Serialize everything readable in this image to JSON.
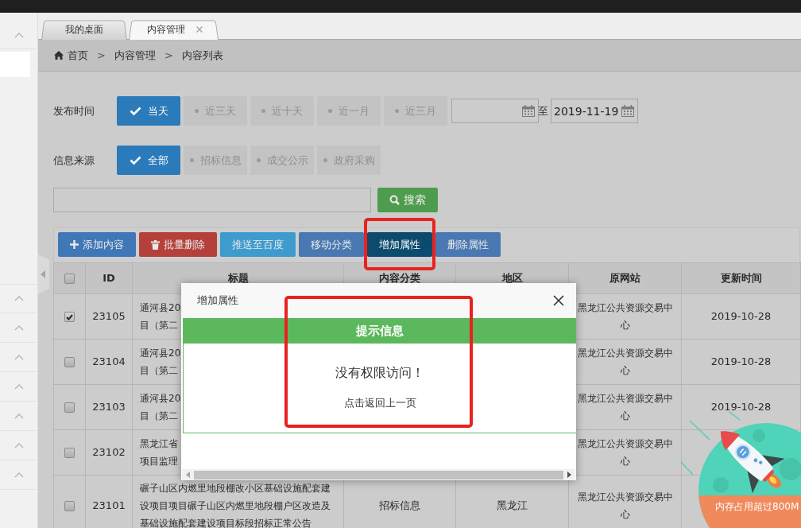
{
  "tabs": [
    {
      "label": "我的桌面",
      "selected": false,
      "closable": false
    },
    {
      "label": "内容管理",
      "selected": true,
      "closable": true
    }
  ],
  "breadcrumb": [
    {
      "kind": "home",
      "label": "首页"
    },
    {
      "kind": "separator",
      "label": ">"
    },
    {
      "kind": "link",
      "label": "内容管理"
    },
    {
      "kind": "separator",
      "label": ">"
    },
    {
      "kind": "current",
      "label": "内容列表"
    }
  ],
  "filters": [
    {
      "label": "发布时间",
      "options": [
        {
          "label": "当天",
          "selected": true
        },
        {
          "label": "近三天",
          "selected": false
        },
        {
          "label": "近十天",
          "selected": false
        },
        {
          "label": "近一月",
          "selected": false
        },
        {
          "label": "近三月",
          "selected": false
        }
      ],
      "date_range": {
        "separator": "至",
        "to_value": "2019-11-19"
      }
    },
    {
      "label": "信息来源",
      "options": [
        {
          "label": "全部",
          "selected": true
        },
        {
          "label": "招标信息",
          "selected": false
        },
        {
          "label": "成交公示",
          "selected": false
        },
        {
          "label": "政府采购",
          "selected": false
        }
      ]
    }
  ],
  "search": {
    "button": "搜索"
  },
  "toolbar": [
    {
      "label": "添加内容",
      "kind": "add",
      "active": false,
      "highlighted": false
    },
    {
      "label": "批量删除",
      "kind": "delete",
      "active": false,
      "highlighted": false
    },
    {
      "label": "推送至百度",
      "kind": "push",
      "active": false,
      "highlighted": false
    },
    {
      "label": "移动分类",
      "kind": "default",
      "active": false,
      "highlighted": false
    },
    {
      "label": "增加属性",
      "kind": "default",
      "active": true,
      "highlighted": true
    },
    {
      "label": "删除属性",
      "kind": "default",
      "active": false,
      "highlighted": false
    }
  ],
  "table": {
    "header_checked": false,
    "columns": [
      "ID",
      "标题",
      "内容分类",
      "地区",
      "原网站",
      "更新时间"
    ],
    "rows": [
      {
        "checked": true,
        "id": "23105",
        "title": [
          "通河县20",
          "目（第二"
        ],
        "site": "黑龙江公共资源交易中心",
        "updated": "2019-10-28"
      },
      {
        "checked": false,
        "id": "23104",
        "title": [
          "通河县20",
          "目（第二"
        ],
        "site": "黑龙江公共资源交易中心",
        "updated": "2019-10-28"
      },
      {
        "checked": false,
        "id": "23103",
        "title": [
          "通河县20",
          "目（第二"
        ],
        "site": "黑龙江公共资源交易中心",
        "updated": "2019-10-28"
      },
      {
        "checked": false,
        "id": "23102",
        "title": [
          "黑龙江省",
          "项目监理"
        ],
        "site": "黑龙江公共资源交易中心"
      },
      {
        "checked": false,
        "id": "23101",
        "title": "碾子山区内燃里地段棚改小区基础设施配套建设项目项目碾子山区内燃里地段棚户区改造及基础设施配套建设项目标段招标正常公告",
        "category": "招标信息",
        "region": "黑龙江",
        "site": "黑龙江公共资源交易中心"
      }
    ]
  },
  "dialog": {
    "title": "增加属性",
    "notice_title": "提示信息",
    "message": "没有权限访问！",
    "link": "点击返回上一页",
    "highlighted": true
  },
  "memory_widget": {
    "message": "内存占用超过800M"
  }
}
